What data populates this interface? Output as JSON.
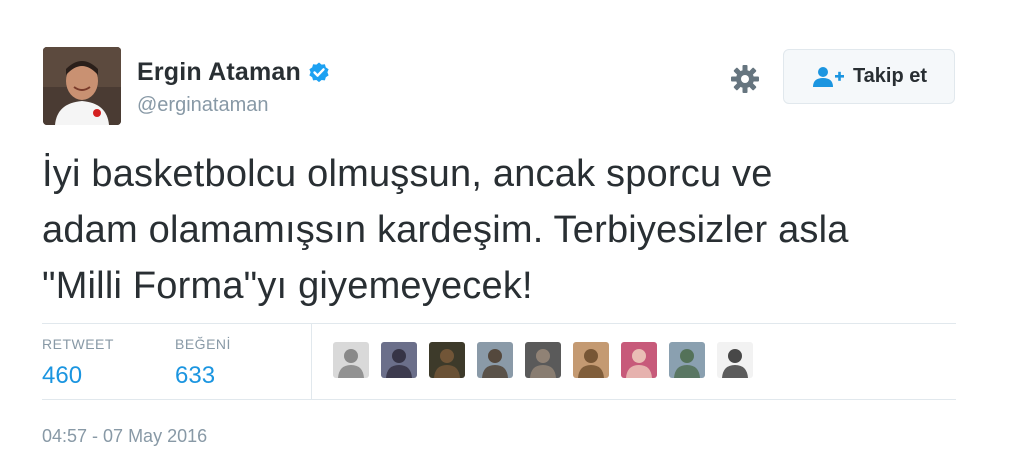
{
  "user": {
    "display_name": "Ergin Ataman",
    "screen_name": "@erginataman",
    "verified": true
  },
  "actions": {
    "follow_label": "Takip et",
    "settings_icon": "gear-icon",
    "follow_icon": "follow-user-icon"
  },
  "tweet": {
    "line1": "İyi basketbolcu olmuşsun, ancak sporcu ve",
    "line2": "adam olamamışsın kardeşim. Terbiyesizler asla",
    "line3": "\"Milli Forma\"yı giyemeyecek!"
  },
  "stats": {
    "retweets_label": "RETWEET",
    "retweets_count": "460",
    "likes_label": "BEĞENİ",
    "likes_count": "633"
  },
  "likers": [
    {
      "colors": [
        "#d9d9d9",
        "#7a7a7a"
      ]
    },
    {
      "colors": [
        "#6b6f8a",
        "#2d2a3a"
      ]
    },
    {
      "colors": [
        "#3d3a2a",
        "#7a5a3a"
      ]
    },
    {
      "colors": [
        "#8a9aa8",
        "#4a3a2a"
      ]
    },
    {
      "colors": [
        "#5a5a5a",
        "#9a8a7a"
      ]
    },
    {
      "colors": [
        "#c49a72",
        "#6a4a2a"
      ]
    },
    {
      "colors": [
        "#c75a7a",
        "#f0d0c0"
      ]
    },
    {
      "colors": [
        "#8aa0b0",
        "#4a6a4a"
      ]
    },
    {
      "colors": [
        "#f2f2f2",
        "#2a2a2a"
      ]
    }
  ],
  "timestamp": "04:57 - 07 May 2016",
  "colors": {
    "link_blue": "#1b95e0",
    "muted_gray": "#8899a6",
    "verified_blue": "#1da1f2"
  }
}
